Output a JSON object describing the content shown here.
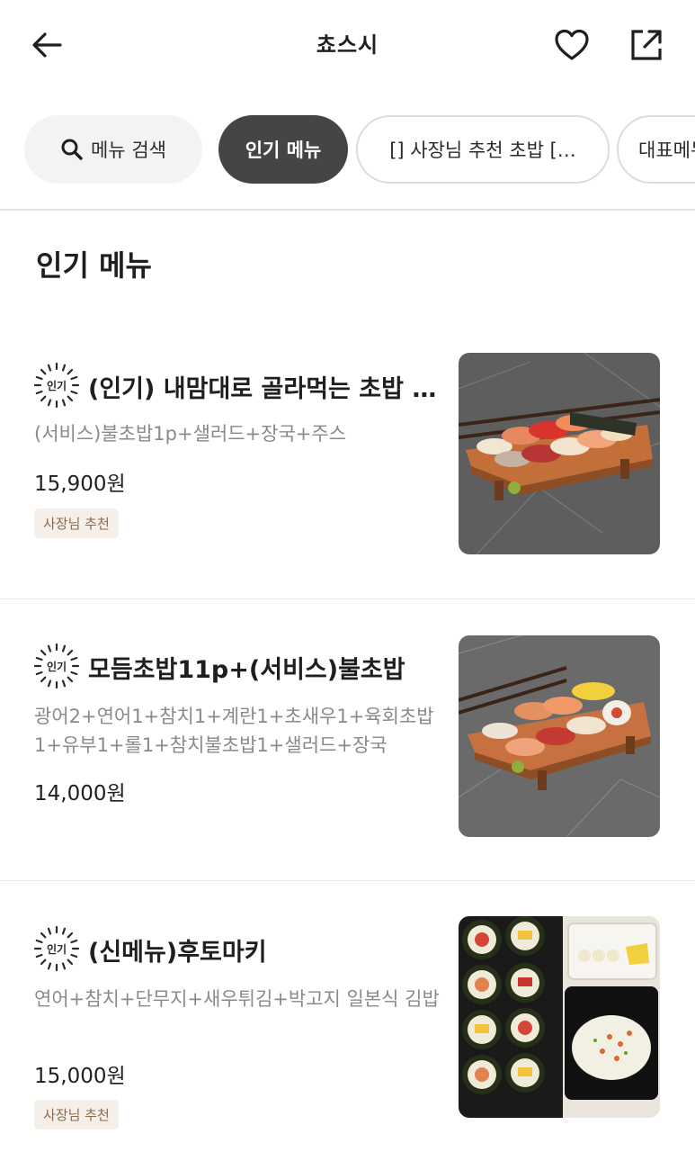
{
  "header": {
    "title": "쵸스시"
  },
  "chips": {
    "search": "메뉴 검색",
    "popular": "인기 메뉴",
    "owner_pick": "[] 사장님 추천 초밥 […",
    "representative": "대표메뉴"
  },
  "section": {
    "title": "인기 메뉴"
  },
  "badge_text": "인기",
  "items": [
    {
      "name": "(인기) 내맘대로 골라먹는 초밥 세트",
      "desc": "(서비스)불초밥1p+샐러드+장국+주스",
      "price": "15,900원",
      "tag": "사장님 추천"
    },
    {
      "name": "모듬초밥11p+(서비스)불초밥",
      "desc": "광어2+연어1+참치1+계란1+초새우1+육회초밥1+유부1+롤1+참치불초밥1+샐러드+장국",
      "price": "14,000원",
      "tag": ""
    },
    {
      "name": "(신메뉴)후토마키",
      "desc": "연어+참치+단무지+새우튀김+박고지 일본식 김밥",
      "price": "15,000원",
      "tag": "사장님 추천"
    }
  ],
  "colors": {
    "active_chip": "#454545",
    "tag_bg": "#f4efe9",
    "tag_text": "#8c6a4e",
    "desc_text": "#8a8a8a"
  },
  "icons": {
    "back": "arrow-left-icon",
    "favorite": "heart-icon",
    "share": "share-icon",
    "search": "search-icon",
    "badge": "popular-sunburst-badge-icon"
  }
}
